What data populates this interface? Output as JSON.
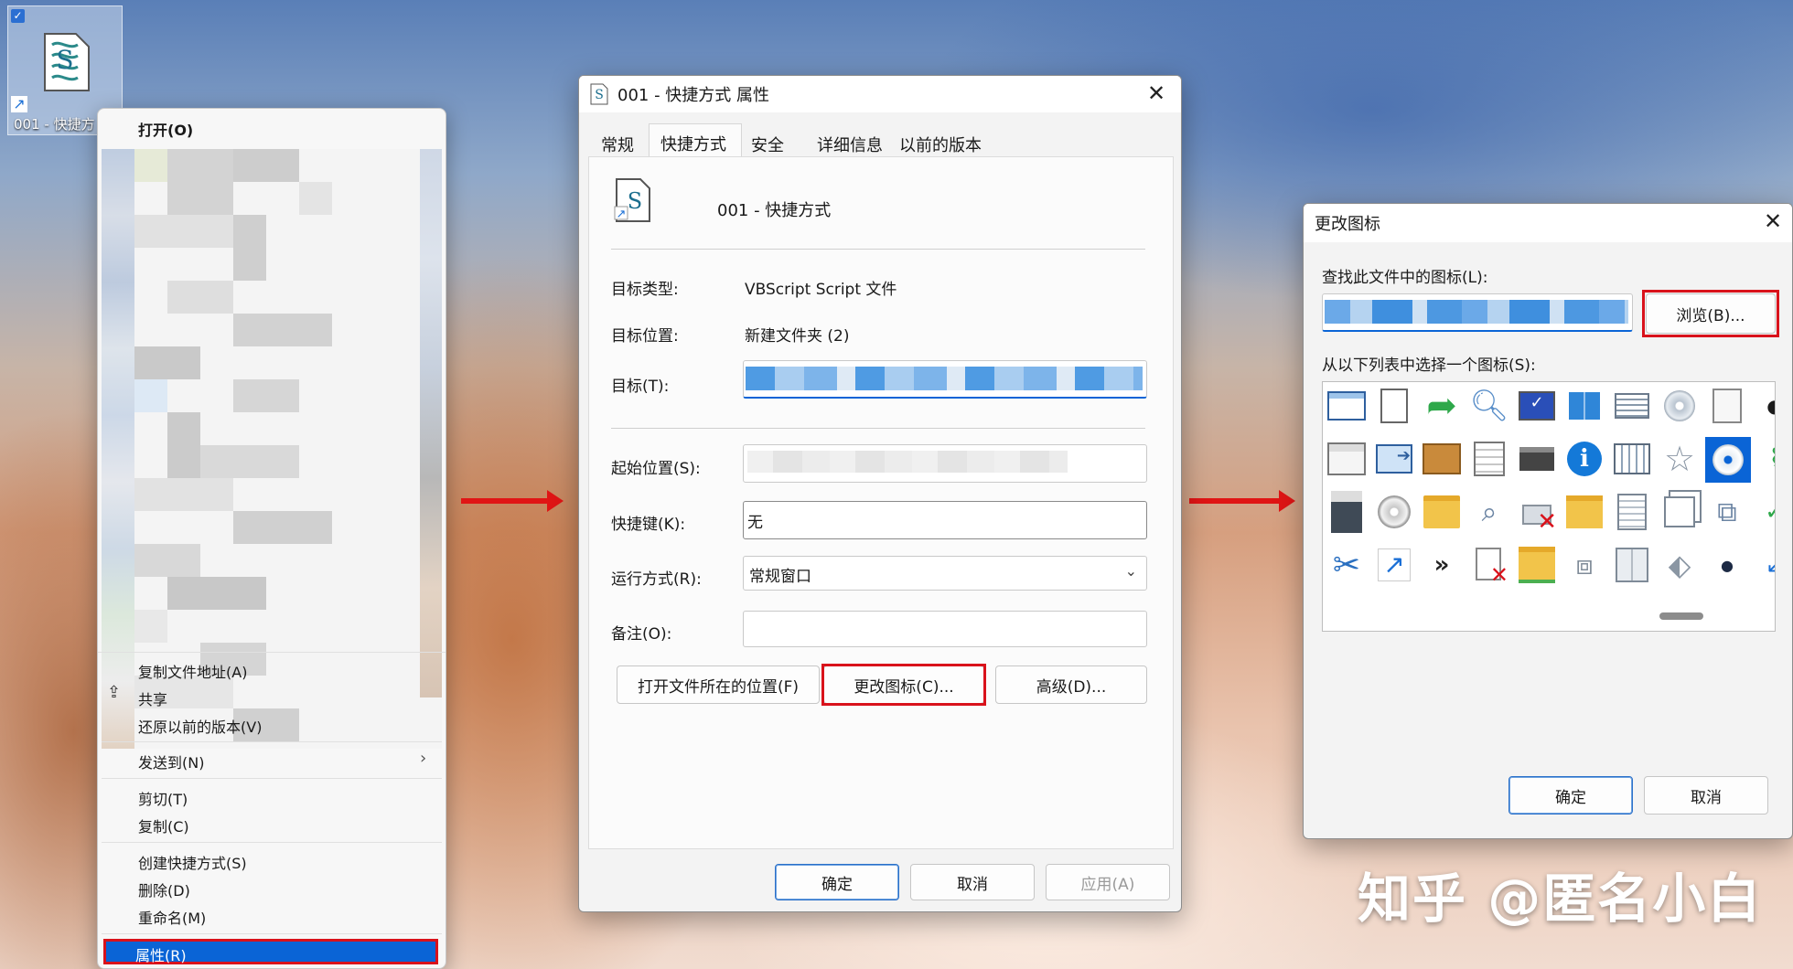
{
  "desktop": {
    "shortcut_label": "001 - 快捷方",
    "watermark": "知乎 @匿名小白"
  },
  "context_menu": {
    "open": "打开(O)",
    "copy_path": "复制文件地址(A)",
    "share": "共享",
    "restore": "还原以前的版本(V)",
    "send_to": "发送到(N)",
    "cut": "剪切(T)",
    "copy": "复制(C)",
    "create_shortcut": "创建快捷方式(S)",
    "delete": "删除(D)",
    "rename": "重命名(M)",
    "properties": "属性(R)"
  },
  "properties": {
    "title": "001 - 快捷方式 属性",
    "tabs": [
      "常规",
      "快捷方式",
      "安全",
      "详细信息",
      "以前的版本"
    ],
    "name": "001 - 快捷方式",
    "target_type_label": "目标类型:",
    "target_type": "VBScript Script 文件",
    "target_location_label": "目标位置:",
    "target_location": "新建文件夹 (2)",
    "target_label": "目标(T):",
    "start_in_label": "起始位置(S):",
    "hotkey_label": "快捷键(K):",
    "hotkey": "无",
    "run_label": "运行方式(R):",
    "run": "常规窗口",
    "comment_label": "备注(O):",
    "open_location_btn": "打开文件所在的位置(F)",
    "change_icon_btn": "更改图标(C)...",
    "advanced_btn": "高级(D)...",
    "ok": "确定",
    "cancel": "取消",
    "apply": "应用(A)"
  },
  "change_icon": {
    "title": "更改图标",
    "find_label": "查找此文件中的图标(L):",
    "browse_btn": "浏览(B)...",
    "select_label": "从以下列表中选择一个图标(S):",
    "ok": "确定",
    "cancel": "取消"
  },
  "colors": {
    "accent_blue": "#0a64d6",
    "highlight_red": "#d9121b"
  }
}
